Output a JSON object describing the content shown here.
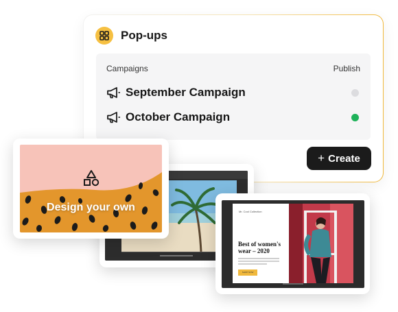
{
  "popups": {
    "title": "Pop-ups",
    "icon": "grid-icon",
    "accent": "#f6c042",
    "columns": {
      "campaigns": "Campaigns",
      "publish": "Publish"
    },
    "campaigns": [
      {
        "name": "September Campaign",
        "icon": "megaphone-icon",
        "published": false,
        "status_color": "#dcdcdf"
      },
      {
        "name": "October Campaign",
        "icon": "megaphone-icon",
        "published": true,
        "status_color": "#1fb25a"
      }
    ],
    "create_button": {
      "icon": "plus-icon",
      "label": "Create"
    }
  },
  "templates": {
    "design_your_own": {
      "label": "Design your own",
      "icon": "shapes-icon"
    },
    "fashion": {
      "headline": "Best of women's wear – 2020",
      "brand": "Mr. Cool Collection",
      "button": "SHOP NOW"
    }
  }
}
